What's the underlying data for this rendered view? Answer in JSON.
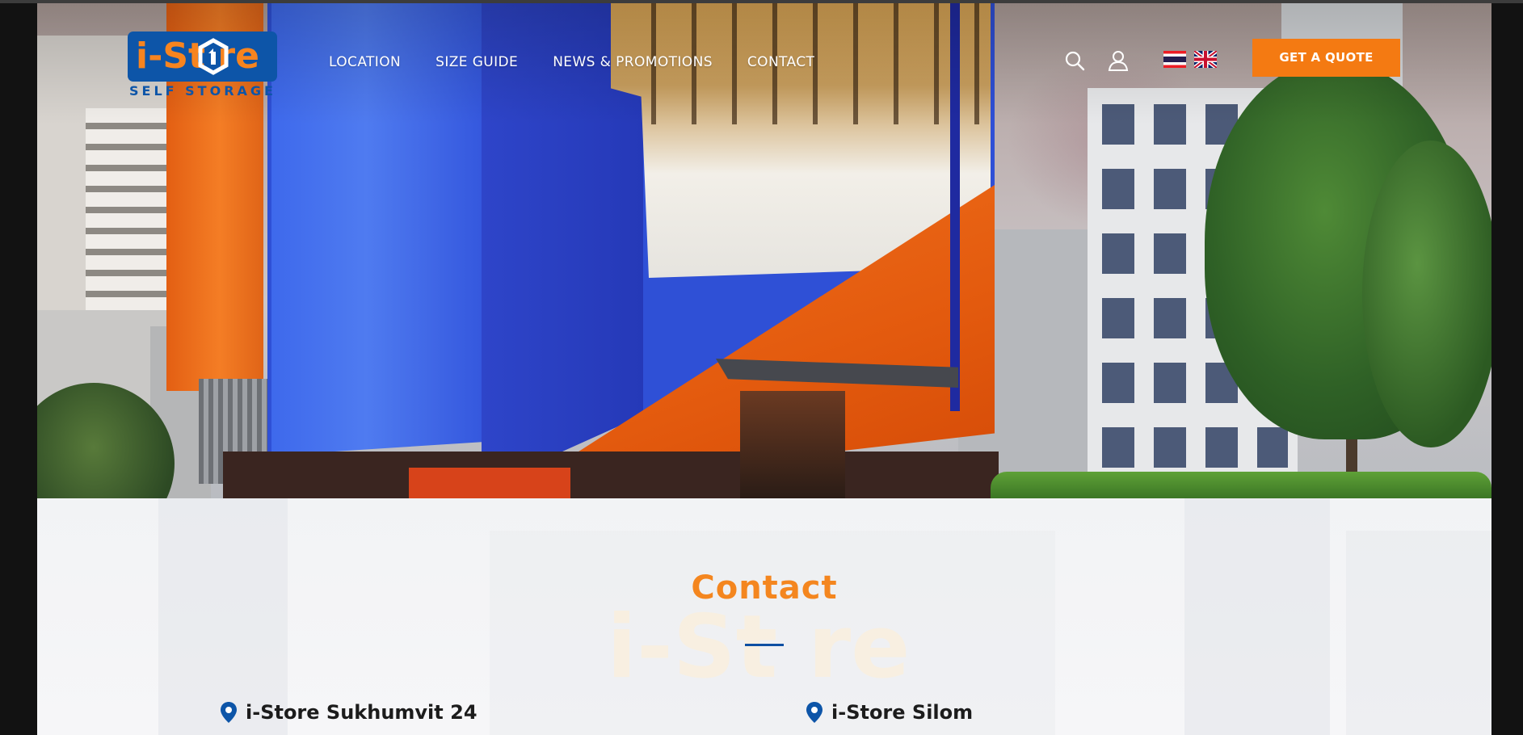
{
  "logo": {
    "wordmark": "i-St re",
    "tagline": "SELF STORAGE"
  },
  "nav": {
    "items": [
      "LOCATION",
      "SIZE GUIDE",
      "NEWS & PROMOTIONS",
      "CONTACT"
    ]
  },
  "header": {
    "cta_label": "GET A QUOTE"
  },
  "contact": {
    "title": "Contact",
    "watermark": "i-St re",
    "locations": [
      {
        "name": "i-Store Sukhumvit 24"
      },
      {
        "name": "i-Store Silom"
      }
    ]
  },
  "colors": {
    "brand_orange": "#f47a12",
    "brand_blue": "#0d55a8"
  },
  "icons": [
    "search-icon",
    "user-icon",
    "thai-flag-icon",
    "uk-flag-icon",
    "location-pin-icon"
  ]
}
